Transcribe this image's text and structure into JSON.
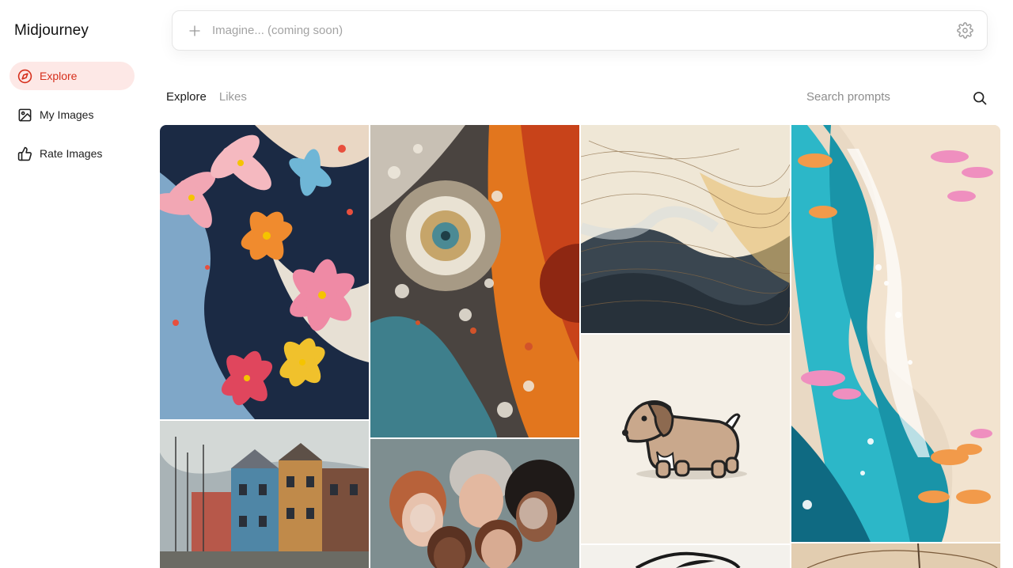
{
  "brand": {
    "title": "Midjourney"
  },
  "sidebar": {
    "items": [
      {
        "label": "Explore",
        "icon": "compass-icon",
        "active": true
      },
      {
        "label": "My Images",
        "icon": "image-icon",
        "active": false
      },
      {
        "label": "Rate Images",
        "icon": "thumbs-up-icon",
        "active": false
      }
    ]
  },
  "prompt": {
    "placeholder": "Imagine... (coming soon)"
  },
  "tabs": [
    {
      "label": "Explore",
      "active": true
    },
    {
      "label": "Likes",
      "active": false
    }
  ],
  "search": {
    "placeholder": "Search prompts"
  },
  "gallery": {
    "images": [
      {
        "subject": "flowers-paint"
      },
      {
        "subject": "abstract-eye"
      },
      {
        "subject": "line-waves"
      },
      {
        "subject": "paper-river"
      },
      {
        "subject": "dachshund"
      },
      {
        "subject": "harbor-houses"
      },
      {
        "subject": "women-portrait"
      },
      {
        "subject": "sketch-bottom"
      },
      {
        "subject": "sepia-bottom"
      }
    ]
  },
  "colors": {
    "accent": "#d62f1c",
    "accent_bg": "#fde8e6"
  }
}
